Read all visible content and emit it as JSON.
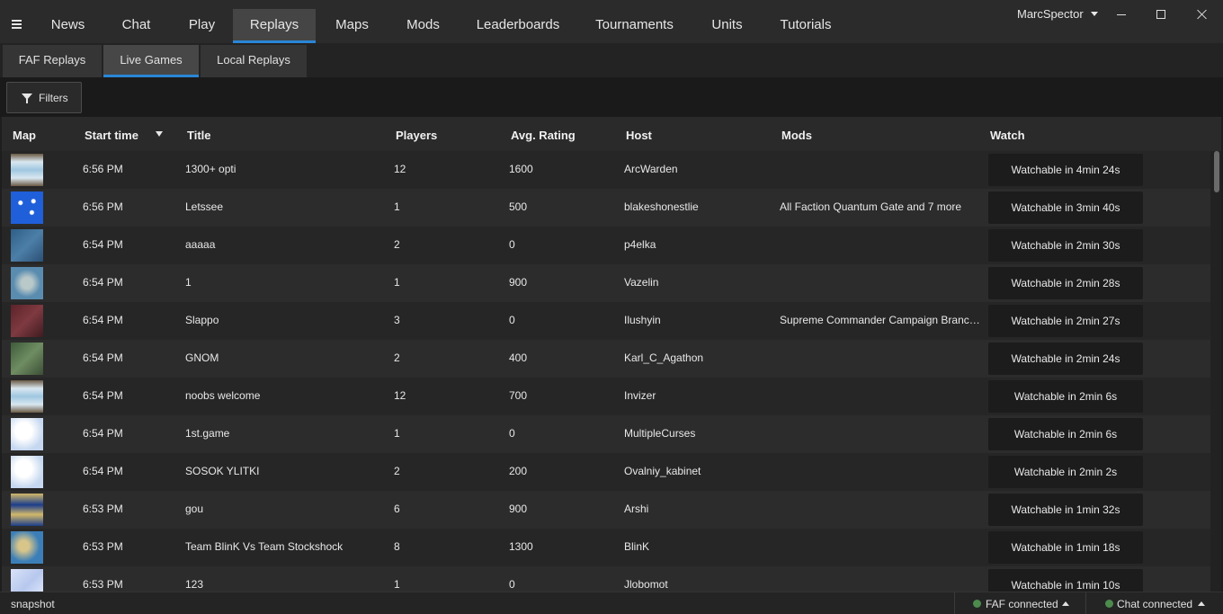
{
  "nav": {
    "tabs": [
      {
        "label": "News"
      },
      {
        "label": "Chat"
      },
      {
        "label": "Play"
      },
      {
        "label": "Replays",
        "active": true
      },
      {
        "label": "Maps"
      },
      {
        "label": "Mods"
      },
      {
        "label": "Leaderboards"
      },
      {
        "label": "Tournaments"
      },
      {
        "label": "Units"
      },
      {
        "label": "Tutorials"
      }
    ],
    "user": "MarcSpector"
  },
  "subtabs": [
    {
      "label": "FAF Replays"
    },
    {
      "label": "Live Games",
      "active": true
    },
    {
      "label": "Local Replays"
    }
  ],
  "toolbar": {
    "filters_label": "Filters"
  },
  "table": {
    "headers": {
      "map": "Map",
      "start_time": "Start time",
      "title": "Title",
      "players": "Players",
      "rating": "Avg. Rating",
      "host": "Host",
      "mods": "Mods",
      "watch": "Watch"
    },
    "rows": [
      {
        "map_icon": "map-thumbnail-snow-bridge",
        "start": "6:56 PM",
        "title": "1300+ opti",
        "players": "12",
        "rating": "1600",
        "host": "ArcWarden",
        "mods": "",
        "watch": "Watchable in 4min 24s"
      },
      {
        "map_icon": "map-thumbnail-blue-dice",
        "start": "6:56 PM",
        "title": "Letssee",
        "players": "1",
        "rating": "500",
        "host": "blakeshonestlie",
        "mods": "All Faction Quantum Gate and 7 more",
        "watch": "Watchable in 3min 40s"
      },
      {
        "map_icon": "map-thumbnail-water",
        "start": "6:54 PM",
        "title": "aaaaa",
        "players": "2",
        "rating": "0",
        "host": "p4elka",
        "mods": "",
        "watch": "Watchable in 2min 30s"
      },
      {
        "map_icon": "map-thumbnail-islands",
        "start": "6:54 PM",
        "title": "1",
        "players": "1",
        "rating": "900",
        "host": "Vazelin",
        "mods": "",
        "watch": "Watchable in 2min 28s"
      },
      {
        "map_icon": "map-thumbnail-red",
        "start": "6:54 PM",
        "title": "Slappo",
        "players": "3",
        "rating": "0",
        "host": "Ilushyin",
        "mods": "Supreme Commander Campaign Branc…",
        "watch": "Watchable in 2min 27s"
      },
      {
        "map_icon": "map-thumbnail-forest",
        "start": "6:54 PM",
        "title": "GNOM",
        "players": "2",
        "rating": "400",
        "host": "Karl_C_Agathon",
        "mods": "",
        "watch": "Watchable in 2min 24s"
      },
      {
        "map_icon": "map-thumbnail-snow-bridge",
        "start": "6:54 PM",
        "title": "noobs welcome",
        "players": "12",
        "rating": "700",
        "host": "Invizer",
        "mods": "",
        "watch": "Watchable in 2min 6s"
      },
      {
        "map_icon": "map-thumbnail-snow",
        "start": "6:54 PM",
        "title": "1st.game",
        "players": "1",
        "rating": "0",
        "host": "MultipleCurses",
        "mods": "",
        "watch": "Watchable in 2min 6s"
      },
      {
        "map_icon": "map-thumbnail-snow",
        "start": "6:54 PM",
        "title": "SOSOK YLITKI",
        "players": "2",
        "rating": "200",
        "host": "Ovalniy_kabinet",
        "mods": "",
        "watch": "Watchable in 2min 2s"
      },
      {
        "map_icon": "map-thumbnail-desert",
        "start": "6:53 PM",
        "title": "gou",
        "players": "6",
        "rating": "900",
        "host": "Arshi",
        "mods": "",
        "watch": "Watchable in 1min 32s"
      },
      {
        "map_icon": "map-thumbnail-blue-islands",
        "start": "6:53 PM",
        "title": "Team BlinK Vs Team Stockshock",
        "players": "8",
        "rating": "1300",
        "host": "BlinK",
        "mods": "",
        "watch": "Watchable in 1min 18s"
      },
      {
        "map_icon": "map-thumbnail-ice",
        "start": "6:53 PM",
        "title": "123",
        "players": "1",
        "rating": "0",
        "host": "Jlobomot",
        "mods": "",
        "watch": "Watchable in 1min 10s"
      }
    ]
  },
  "status": {
    "left": "snapshot",
    "faf": "FAF connected",
    "chat": "Chat connected",
    "connected_color": "#4d8a4d"
  },
  "colors": {
    "accent": "#2a86d6"
  }
}
